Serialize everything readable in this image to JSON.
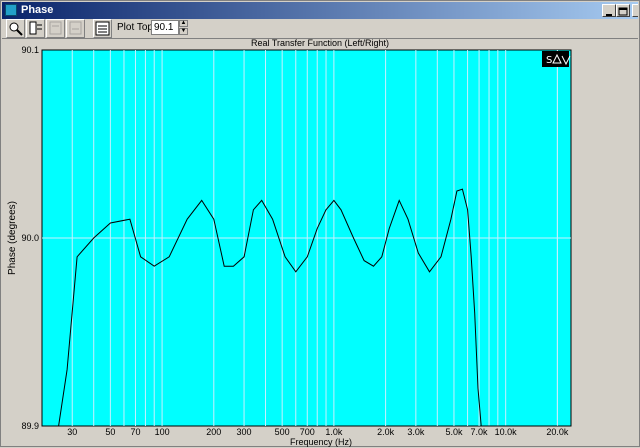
{
  "window": {
    "title": "Phase"
  },
  "toolbar": {
    "tools": [
      {
        "name": "zoom-icon",
        "disabled": false
      },
      {
        "name": "cursor-on-icon",
        "disabled": false
      },
      {
        "name": "cursor-off-icon",
        "disabled": true
      },
      {
        "name": "cursor-show-icon",
        "disabled": true
      },
      {
        "name": "properties-icon",
        "disabled": false
      }
    ],
    "plot_top_label": "Plot Top:",
    "plot_top_value": "90.1"
  },
  "colors": {
    "plot_bg": "#00ffff",
    "grid": "#c8f0ff",
    "trace": "#000000"
  },
  "chart_data": {
    "type": "line",
    "title": "Real Transfer Function (Left/Right)",
    "xlabel": "Frequency (Hz)",
    "ylabel": "Phase (degrees)",
    "xscale": "log",
    "xlim": [
      20,
      24000
    ],
    "ylim": [
      89.9,
      90.1
    ],
    "yticks": [
      "90.1",
      "90.0",
      "89.9"
    ],
    "xticks": [
      "30",
      "50",
      "70",
      "100",
      "200",
      "300",
      "500",
      "700",
      "1.0k",
      "2.0k",
      "3.0k",
      "5.0k",
      "7.0k",
      "10.0k",
      "20.0k"
    ],
    "grid": true,
    "series": [
      {
        "x": [
          20,
          25,
          28,
          32,
          40,
          50,
          65,
          75,
          90,
          110,
          140,
          170,
          200,
          230,
          260,
          300,
          340,
          380,
          440,
          520,
          600,
          700,
          800,
          900,
          1000,
          1100,
          1300,
          1500,
          1700,
          1900,
          2100,
          2400,
          2700,
          3100,
          3600,
          4200,
          4800,
          5200,
          5600,
          6000,
          6300,
          6600,
          6900,
          7200,
          10000,
          15000,
          20000
        ],
        "y": [
          89.9,
          89.9,
          89.93,
          89.99,
          90.0,
          90.008,
          90.01,
          89.99,
          89.985,
          89.99,
          90.01,
          90.02,
          90.01,
          89.985,
          89.985,
          89.99,
          90.015,
          90.02,
          90.01,
          89.99,
          89.982,
          89.99,
          90.005,
          90.015,
          90.02,
          90.015,
          90.0,
          89.988,
          89.985,
          89.99,
          90.005,
          90.02,
          90.01,
          89.992,
          89.982,
          89.99,
          90.01,
          90.025,
          90.026,
          90.015,
          89.99,
          89.96,
          89.92,
          89.9,
          89.9,
          89.9,
          89.9
        ]
      }
    ]
  }
}
